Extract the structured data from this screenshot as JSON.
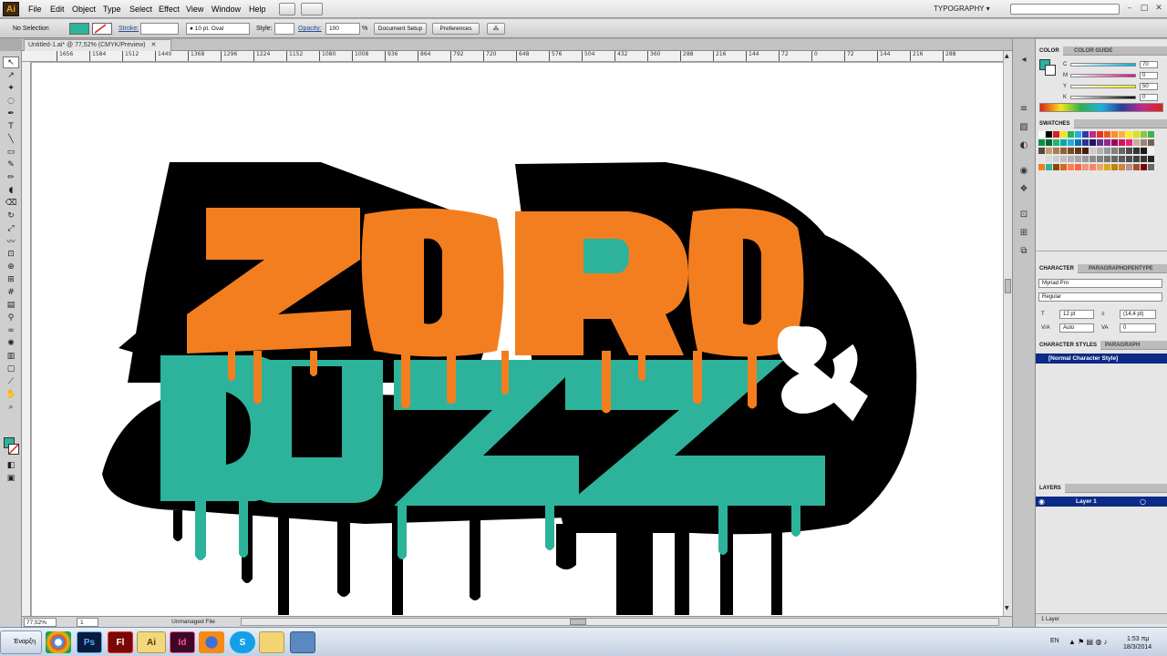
{
  "app": {
    "logo": "Ai",
    "workspace": "TYPOGRAPHY ▾"
  },
  "menu": [
    "File",
    "Edit",
    "Object",
    "Type",
    "Select",
    "Effect",
    "View",
    "Window",
    "Help"
  ],
  "control": {
    "selection": "No Selection",
    "stroke_label": "Stroke:",
    "brush": "10 pt. Oval",
    "style_label": "Style:",
    "opacity_label": "Opacity:",
    "opacity_value": "100",
    "opacity_unit": "%",
    "document_setup": "Document Setup",
    "preferences": "Preferences",
    "fill_color": "#2db39b"
  },
  "document": {
    "tab_title": "Untitled-1.ai* @ 77,52% (CMYK/Preview)"
  },
  "ruler": [
    "1656",
    "1584",
    "1512",
    "1440",
    "1368",
    "1296",
    "1224",
    "1152",
    "1080",
    "1008",
    "936",
    "864",
    "792",
    "720",
    "648",
    "576",
    "504",
    "432",
    "360",
    "288",
    "216",
    "144",
    "72",
    "0",
    "72",
    "144",
    "216",
    "288"
  ],
  "artwork": {
    "line1": "ZORO",
    "amp": "&",
    "line2": "BUZZ",
    "colors": {
      "orange": "#f37e1f",
      "teal": "#2db39b",
      "black": "#000000",
      "white": "#ffffff"
    }
  },
  "status": {
    "zoom": "77,52%",
    "artboard": "1",
    "file_status": "Unmanaged File"
  },
  "panels": {
    "color_tabs": [
      "COLOR",
      "COLOR GUIDE"
    ],
    "cmyk": [
      {
        "label": "C",
        "value": "70"
      },
      {
        "label": "M",
        "value": "0"
      },
      {
        "label": "Y",
        "value": "50"
      },
      {
        "label": "K",
        "value": "0"
      }
    ],
    "swatches_tab": "SWATCHES",
    "character_tabs": [
      "CHARACTER",
      "PARAGRAPH",
      "OPENTYPE"
    ],
    "font_family": "Myriad Pro",
    "font_style": "Regular",
    "font_size": "12 pt",
    "leading": "(14,4 pt)",
    "kerning": "Auto",
    "tracking": "0",
    "char_styles_tabs": [
      "CHARACTER STYLES",
      "PARAGRAPH"
    ],
    "char_style_item": "[Normal Character Style]",
    "layers_tab": "LAYERS",
    "layer_name": "Layer 1",
    "layers_count": "1 Layer"
  },
  "taskbar": {
    "start": "Έναρξη",
    "apps": [
      "Chrome",
      "Ps",
      "Fl",
      "Ai",
      "Id",
      "Firefox",
      "Skype",
      "Folder",
      "Screen"
    ],
    "lang": "EN",
    "time": "1:53 πμ",
    "date": "18/3/2014"
  }
}
